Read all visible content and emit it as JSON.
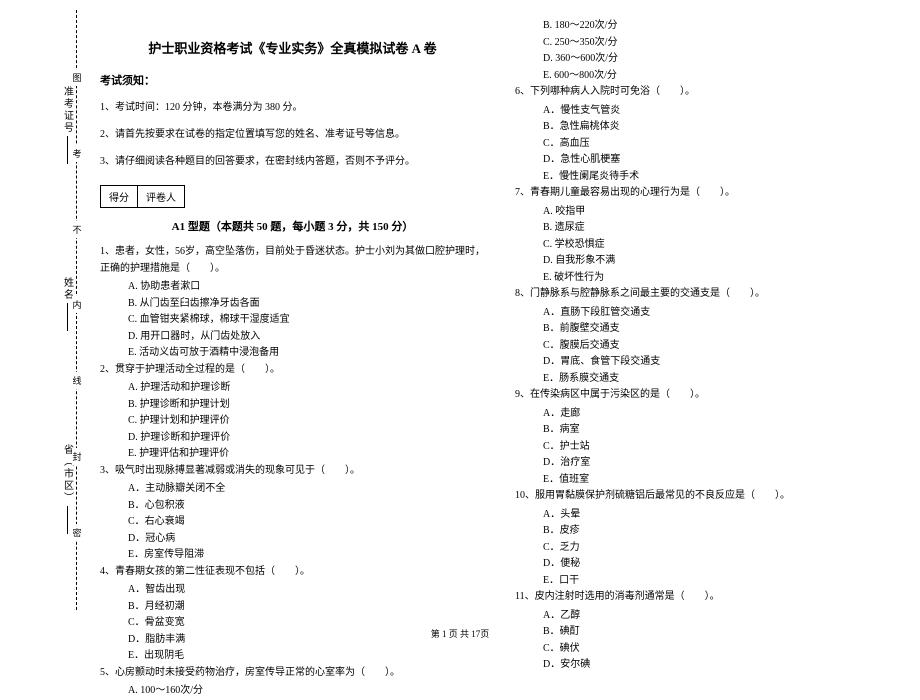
{
  "binding": {
    "labels": [
      "准考证号",
      "姓名",
      "省（市区）"
    ],
    "dashed": [
      "图",
      "考",
      "不",
      "内",
      "线",
      "封",
      "密"
    ]
  },
  "title": "护士职业资格考试《专业实务》全真模拟试卷 A 卷",
  "notice_header": "考试须知：",
  "notices": [
    "1、考试时间：120 分钟，本卷满分为 380 分。",
    "2、请首先按要求在试卷的指定位置填写您的姓名、准考证号等信息。",
    "3、请仔细阅读各种题目的回答要求，在密封线内答题，否则不予评分。"
  ],
  "scorebox": {
    "c1": "得分",
    "c2": "评卷人"
  },
  "section_title": "A1 型题（本题共 50 题，每小题 3 分，共 150 分）",
  "left_questions": [
    {
      "stem": "1、患者，女性，56岁，高空坠落伤，目前处于昏迷状态。护士小刘为其做口腔护理时，正确的护理措施是（　　）。",
      "opts": [
        "A. 协助患者漱口",
        "B. 从门齿至臼齿擦净牙齿各面",
        "C. 血管钳夹紧棉球，棉球干湿度适宜",
        "D. 用开口器时，从门齿处放入",
        "E. 活动义齿可放于酒精中浸泡备用"
      ]
    },
    {
      "stem": "2、贯穿于护理活动全过程的是（　　）。",
      "opts": [
        "A. 护理活动和护理诊断",
        "B. 护理诊断和护理计划",
        "C. 护理计划和护理评价",
        "D. 护理诊断和护理评价",
        "E. 护理评估和护理评价"
      ]
    },
    {
      "stem": "3、吸气时出现脉搏显著减弱或消失的现象可见于（　　）。",
      "opts": [
        "A．主动脉瓣关闭不全",
        "B．心包积液",
        "C．右心衰竭",
        "D．冠心病",
        "E．房室传导阻滞"
      ]
    },
    {
      "stem": "4、青春期女孩的第二性征表现不包括（　　）。",
      "opts": [
        "A．智齿出现",
        "B．月经初潮",
        "C．骨盆变宽",
        "D．脂肪丰满",
        "E．出现阴毛"
      ]
    },
    {
      "stem": "5、心房颤动时未接受药物治疗，房室传导正常的心室率为（　　）。",
      "opts": [
        "A. 100～160次/分"
      ]
    }
  ],
  "right_top_opts": [
    "B. 180～220次/分",
    "C. 250～350次/分",
    "D. 360～600次/分",
    "E. 600～800次/分"
  ],
  "right_questions": [
    {
      "stem": "6、下列哪种病人入院时可免浴（　　）。",
      "opts": [
        "A．慢性支气管炎",
        "B．急性扁桃体炎",
        "C．高血压",
        "D．急性心肌梗塞",
        "E．慢性阑尾炎待手术"
      ]
    },
    {
      "stem": "7、青春期儿童最容易出现的心理行为是（　　）。",
      "opts": [
        "A. 咬指甲",
        "B. 遗尿症",
        "C. 学校恐惧症",
        "D. 自我形象不满",
        "E. 破坏性行为"
      ]
    },
    {
      "stem": "8、门静脉系与腔静脉系之间最主要的交通支是（　　）。",
      "opts": [
        "A．直肠下段肛管交通支",
        "B．前腹壁交通支",
        "C．腹膜后交通支",
        "D．胃底、食管下段交通支",
        "E．肠系膜交通支"
      ]
    },
    {
      "stem": "9、在传染病区中属于污染区的是（　　）。",
      "opts": [
        "A．走廊",
        "B．病室",
        "C．护士站",
        "D．治疗室",
        "E．值班室"
      ]
    },
    {
      "stem": "10、服用胃黏膜保护剂硫糖铝后最常见的不良反应是（　　）。",
      "opts": [
        "A．头晕",
        "B．皮疹",
        "C．乏力",
        "D．便秘",
        "E．口干"
      ]
    },
    {
      "stem": "11、皮内注射时选用的消毒剂通常是（　　）。",
      "opts": [
        "A．乙醇",
        "B．碘酊",
        "C．碘伏",
        "D．安尔碘"
      ]
    }
  ],
  "footer": "第 1 页 共 17页"
}
